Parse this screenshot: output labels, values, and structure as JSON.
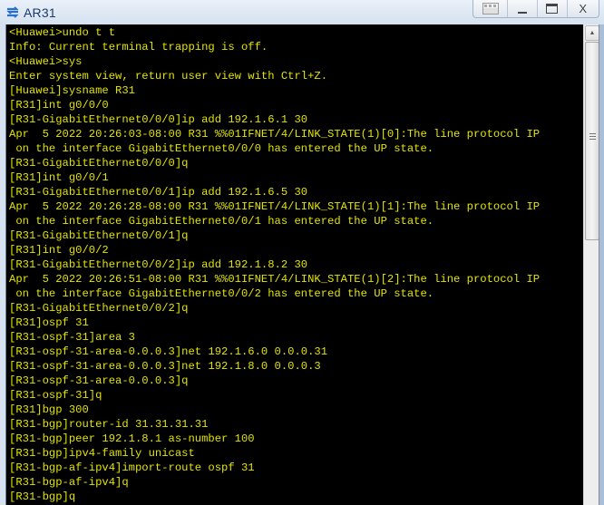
{
  "window": {
    "title": "AR31",
    "app_icon": "router-icon",
    "controls": [
      {
        "name": "restore-layout-button",
        "icon": "layout-icon",
        "glyph": "▤"
      },
      {
        "name": "minimize-button",
        "icon": "minimize-icon",
        "glyph": "_"
      },
      {
        "name": "maximize-button",
        "icon": "maximize-icon",
        "glyph": "▭"
      },
      {
        "name": "close-button",
        "icon": "close-icon",
        "glyph": "X"
      }
    ]
  },
  "terminal": {
    "text_color": "#e3e300",
    "background": "#000000",
    "lines": [
      "<Huawei>undo t t",
      "Info: Current terminal trapping is off.",
      "<Huawei>sys",
      "Enter system view, return user view with Ctrl+Z.",
      "[Huawei]sysname R31",
      "[R31]int g0/0/0",
      "[R31-GigabitEthernet0/0/0]ip add 192.1.6.1 30",
      "Apr  5 2022 20:26:03-08:00 R31 %%01IFNET/4/LINK_STATE(1)[0]:The line protocol IP",
      " on the interface GigabitEthernet0/0/0 has entered the UP state.",
      "[R31-GigabitEthernet0/0/0]q",
      "[R31]int g0/0/1",
      "[R31-GigabitEthernet0/0/1]ip add 192.1.6.5 30",
      "Apr  5 2022 20:26:28-08:00 R31 %%01IFNET/4/LINK_STATE(1)[1]:The line protocol IP",
      " on the interface GigabitEthernet0/0/1 has entered the UP state.",
      "[R31-GigabitEthernet0/0/1]q",
      "[R31]int g0/0/2",
      "[R31-GigabitEthernet0/0/2]ip add 192.1.8.2 30",
      "Apr  5 2022 20:26:51-08:00 R31 %%01IFNET/4/LINK_STATE(1)[2]:The line protocol IP",
      " on the interface GigabitEthernet0/0/2 has entered the UP state.",
      "[R31-GigabitEthernet0/0/2]q",
      "[R31]ospf 31",
      "[R31-ospf-31]area 3",
      "[R31-ospf-31-area-0.0.0.3]net 192.1.6.0 0.0.0.31",
      "[R31-ospf-31-area-0.0.0.3]net 192.1.8.0 0.0.0.3",
      "[R31-ospf-31-area-0.0.0.3]q",
      "[R31-ospf-31]q",
      "[R31]bgp 300",
      "[R31-bgp]router-id 31.31.31.31",
      "[R31-bgp]peer 192.1.8.1 as-number 100",
      "[R31-bgp]ipv4-family unicast",
      "[R31-bgp-af-ipv4]import-route ospf 31",
      "[R31-bgp-af-ipv4]q",
      "[R31-bgp]q"
    ]
  },
  "scrollbar": {
    "orientation": "vertical",
    "thumb_position_fraction": 0.0,
    "visible_fraction": 0.42
  }
}
